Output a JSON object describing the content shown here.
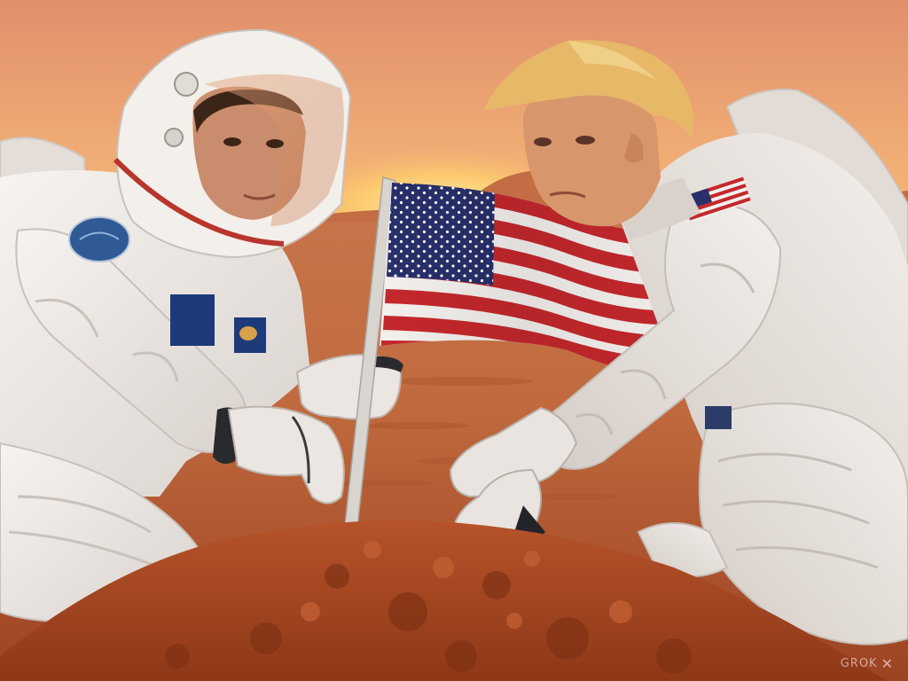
{
  "image": {
    "kind": "photo-illustration",
    "description_colors": {
      "sky_top": "#e59872",
      "sky_glow": "#ffd072",
      "ground": "#b8542c",
      "suit": "#ece9e6"
    }
  },
  "watermark": {
    "text": "GROK",
    "mark": "✕"
  }
}
